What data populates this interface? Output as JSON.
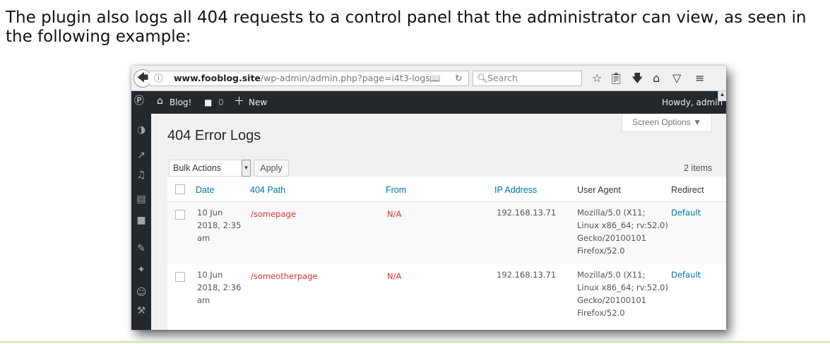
{
  "intro_text": "The plugin also logs all 404 requests to a control panel that the administrator can view, as seen in the following example:",
  "browser": {
    "url_host": "www.fooblog.site",
    "url_path": "/wp-admin/admin.php?page=i4t3-logs",
    "search_placeholder": "Search"
  },
  "admin_bar": {
    "site_name": "Blog!",
    "comments_count": "0",
    "new_label": "New",
    "howdy": "Howdy, admin"
  },
  "page": {
    "title": "404 Error Logs",
    "screen_options": "Screen Options ▼",
    "bulk_actions": "Bulk Actions",
    "apply_label": "Apply",
    "items_count": "2 items"
  },
  "table": {
    "headers": [
      "Date",
      "404 Path",
      "From",
      "IP Address",
      "User Agent",
      "Redirect"
    ],
    "rows": [
      {
        "date": [
          "10 Jun",
          "2018, 2:35",
          "am"
        ],
        "path": "/somepage",
        "from": "N/A",
        "ip": "192.168.13.71",
        "agent": [
          "Mozilla/5.0 (X11;",
          "Linux x86_64; rv:52.0)",
          "Gecko/20100101",
          "Firefox/52.0"
        ],
        "redirect": "Default"
      },
      {
        "date": [
          "10 Jun",
          "2018, 2:36",
          "am"
        ],
        "path": "/someotherpage",
        "from": "N/A",
        "ip": "192.168.13.71",
        "agent": [
          "Mozilla/5.0 (X11;",
          "Linux x86_64; rv:52.0)",
          "Gecko/20100101",
          "Firefox/52.0"
        ],
        "redirect": "Default"
      }
    ]
  },
  "colors": {
    "admin_bar": "#23282d",
    "link": "#0073aa",
    "error_red": "#dc3232"
  }
}
